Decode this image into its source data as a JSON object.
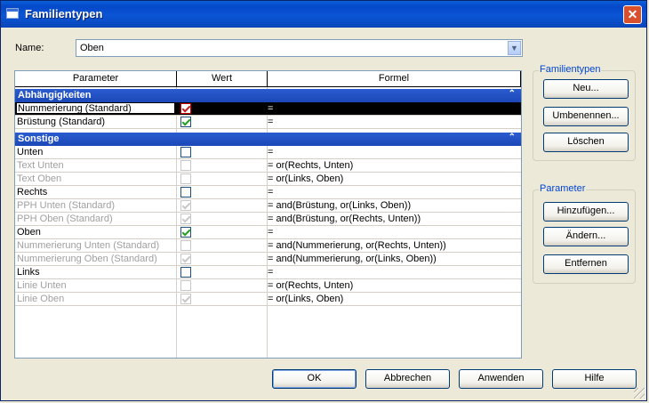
{
  "window": {
    "title": "Familientypen"
  },
  "name": {
    "label": "Name:",
    "value": "Oben"
  },
  "table": {
    "headers": [
      "Parameter",
      "Wert",
      "Formel"
    ],
    "groups": [
      {
        "title": "Abhängigkeiten",
        "rows": [
          {
            "name": "Nummerierung (Standard)",
            "checked": true,
            "disabled": false,
            "formula": "=",
            "selected": true
          },
          {
            "name": "Brüstung (Standard)",
            "checked": true,
            "disabled": false,
            "formula": "="
          }
        ]
      },
      {
        "title": "Sonstige",
        "rows": [
          {
            "name": "Unten",
            "checked": false,
            "disabled": false,
            "formula": "="
          },
          {
            "name": "Text Unten",
            "checked": false,
            "disabled": true,
            "formula": "= or(Rechts, Unten)"
          },
          {
            "name": "Text Oben",
            "checked": false,
            "disabled": true,
            "formula": "= or(Links, Oben)"
          },
          {
            "name": "Rechts",
            "checked": false,
            "disabled": false,
            "formula": "="
          },
          {
            "name": "PPH Unten (Standard)",
            "checked": true,
            "disabled": true,
            "formula": "= and(Brüstung, or(Links, Oben))"
          },
          {
            "name": "PPH Oben (Standard)",
            "checked": true,
            "disabled": true,
            "formula": "= and(Brüstung, or(Rechts, Unten))"
          },
          {
            "name": "Oben",
            "checked": true,
            "disabled": false,
            "formula": "="
          },
          {
            "name": "Nummerierung Unten (Standard)",
            "checked": false,
            "disabled": true,
            "formula": "= and(Nummerierung, or(Rechts, Unten))"
          },
          {
            "name": "Nummerierung Oben (Standard)",
            "checked": true,
            "disabled": true,
            "formula": "= and(Nummerierung, or(Links, Oben))"
          },
          {
            "name": "Links",
            "checked": false,
            "disabled": false,
            "formula": "="
          },
          {
            "name": "Linie Unten",
            "checked": false,
            "disabled": true,
            "formula": "= or(Rechts, Unten)"
          },
          {
            "name": "Linie Oben",
            "checked": true,
            "disabled": true,
            "formula": "= or(Links, Oben)"
          }
        ]
      }
    ]
  },
  "familientypen_group": {
    "title": "Familientypen",
    "new_label": "Neu...",
    "rename_label": "Umbenennen...",
    "delete_label": "Löschen"
  },
  "parameter_group": {
    "title": "Parameter",
    "add_label": "Hinzufügen...",
    "modify_label": "Ändern...",
    "remove_label": "Entfernen"
  },
  "footer": {
    "ok_label": "OK",
    "cancel_label": "Abbrechen",
    "apply_label": "Anwenden",
    "help_label": "Hilfe"
  },
  "colors": {
    "titlebar": "#0a55d6",
    "group_header": "#1c48b8",
    "check": "#21a121"
  }
}
